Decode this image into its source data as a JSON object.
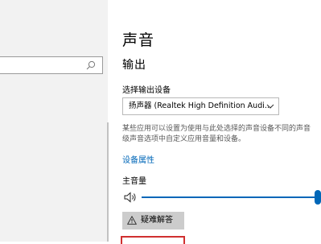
{
  "search": {
    "placeholder": ""
  },
  "page": {
    "title": "声音"
  },
  "output": {
    "section_title": "输出",
    "select_label": "选择输出设备",
    "selected_device": "扬声器 (Realtek High Definition Audi...",
    "description_line1": "某些应用可以设置为使用与此处选择的声音设备不同的声音",
    "description_line2": "级声音选项中自定义应用音量和设备。",
    "properties_link": "设备属性",
    "volume_label": "主音量",
    "volume_level_fraction": 1.0,
    "troubleshoot_label": "疑难解答"
  },
  "colors": {
    "accent": "#0067b8",
    "nav_bg": "#f2f2f2",
    "button_bg": "#cccccc",
    "highlight_border": "#d03030"
  }
}
